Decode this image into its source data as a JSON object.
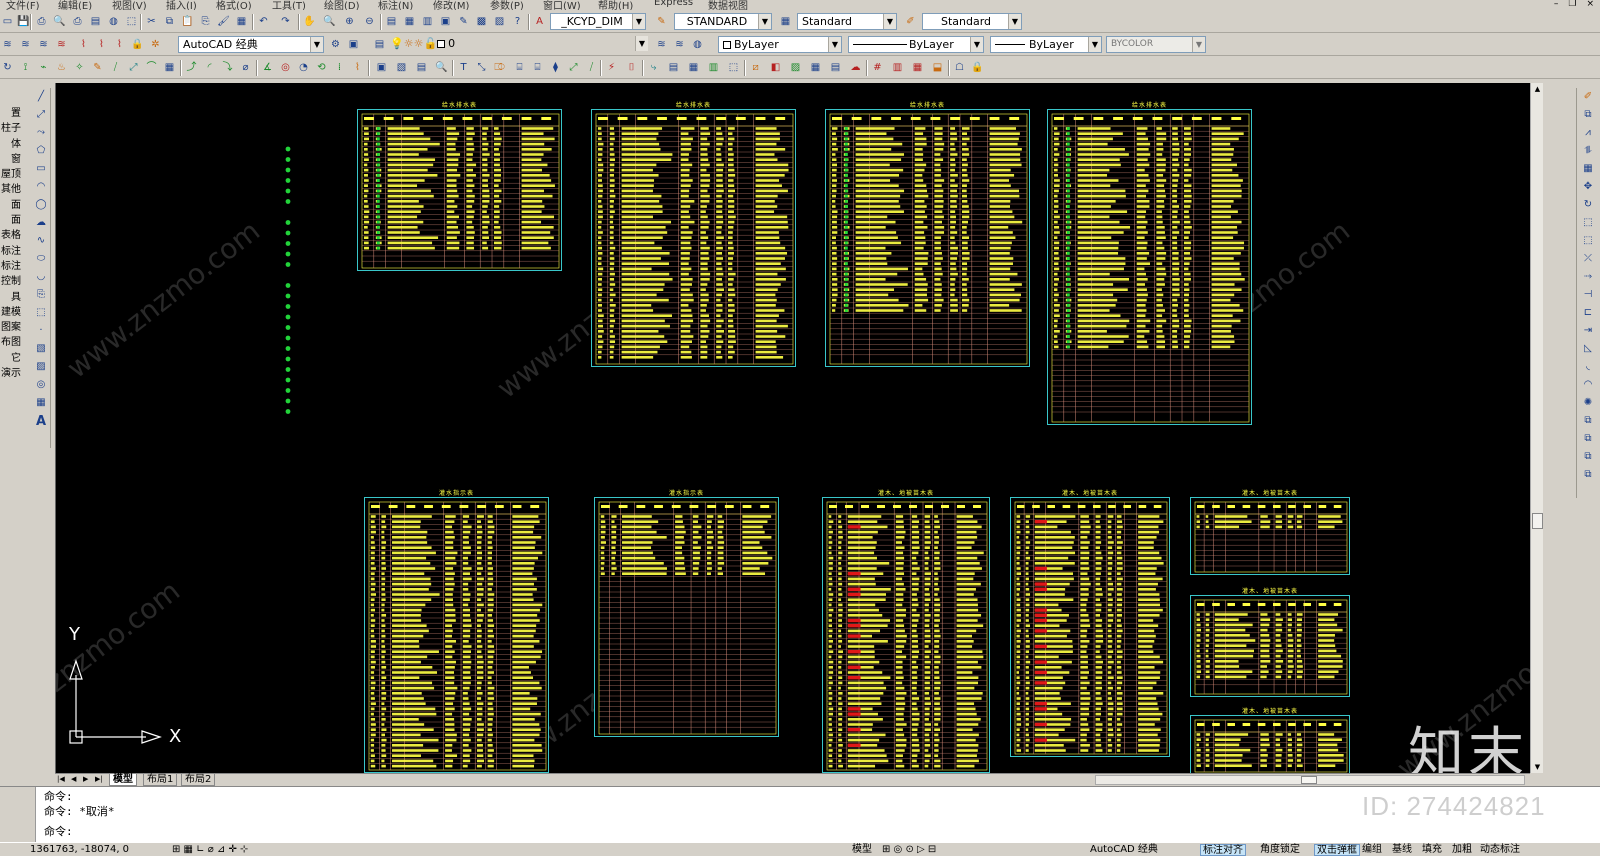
{
  "menu": [
    "文件(F)",
    "编辑(E)",
    "视图(V)",
    "插入(I)",
    "格式(O)",
    "工具(T)",
    "绘图(D)",
    "标注(N)",
    "修改(M)",
    "参数(P)",
    "窗口(W)",
    "帮助(H)",
    "Express",
    "数据视图"
  ],
  "styles_toolbar": {
    "text_style": "_KCYD_DIM",
    "dim_style": "STANDARD",
    "table_style": "Standard",
    "mleader_style": "Standard"
  },
  "workspace": "AutoCAD 经典",
  "layer": "0",
  "properties": {
    "color": "ByLayer",
    "linetype": "ByLayer",
    "lineweight": "ByLayer",
    "plot_style": "BYCOLOR"
  },
  "palette_labels": [
    "置",
    "柱子",
    "体",
    "窗",
    "屋顶",
    "其他",
    "面",
    "面",
    "表格",
    "标注",
    "标注",
    "控制",
    "具",
    "建模",
    "图案",
    "布图",
    "它",
    "演示"
  ],
  "sheets": {
    "t1": "给水排水表",
    "t2": "给水排水表",
    "t3": "给水排水表",
    "t4": "给水排水表",
    "b1": "灌水指示表",
    "b2": "灌水指示表",
    "b3": "灌木、地被苗木表",
    "b4": "灌木、地被苗木表",
    "b5": "灌木、地被苗木表",
    "b6": "灌木、地被苗木表",
    "b7": "灌木、地被苗木表"
  },
  "ucs": {
    "x": "X",
    "y": "Y"
  },
  "layout_tabs": [
    "模型",
    "布局1",
    "布局2"
  ],
  "command_lines": [
    "命令:",
    "命令: *取消*",
    "命令:"
  ],
  "status": {
    "coords": "1361763, -18074, 0",
    "right_buttons": [
      "模型",
      "AutoCAD 经典",
      "标注对齐",
      "角度锁定",
      "双击弹框",
      "编组",
      "基线",
      "填充",
      "加粗",
      "动态标注"
    ]
  },
  "watermark": {
    "site": "www.znzmo.com",
    "logo": "知末",
    "id": "ID: 274424821"
  },
  "colors": {
    "canvas": "#000000",
    "sheet_border": "#39c6c9",
    "table_grid": "#d58a78",
    "text": "#ffff45",
    "marker": "#22d43a",
    "alert": "#e01818"
  }
}
